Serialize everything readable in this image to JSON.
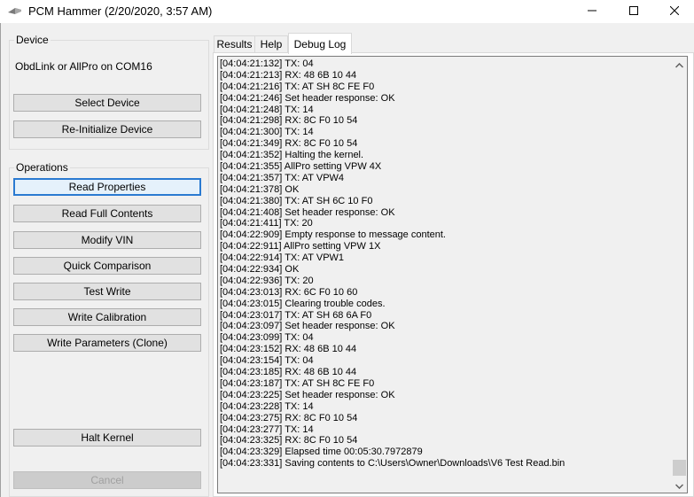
{
  "window": {
    "title": "PCM Hammer (2/20/2020, 3:57 AM)",
    "controls": {
      "minimize": "minimize-icon",
      "maximize": "maximize-icon",
      "close": "close-icon"
    }
  },
  "device_group": {
    "label": "Device",
    "device_name": "ObdLink or AllPro on COM16",
    "buttons": {
      "select": "Select Device",
      "reinit": "Re-Initialize Device"
    }
  },
  "operations_group": {
    "label": "Operations",
    "buttons": {
      "read_properties": "Read Properties",
      "read_full": "Read Full Contents",
      "modify_vin": "Modify VIN",
      "quick_compare": "Quick Comparison",
      "test_write": "Test Write",
      "write_calibration": "Write Calibration",
      "write_parameters": "Write Parameters (Clone)",
      "halt_kernel": "Halt Kernel",
      "cancel": "Cancel"
    }
  },
  "tabs": {
    "results": "Results",
    "help": "Help",
    "debug_log": "Debug Log",
    "active": "debug_log"
  },
  "debug_log": {
    "lines": [
      "[04:04:21:132]  TX: 04",
      "[04:04:21:213]  RX: 48 6B 10 44",
      "[04:04:21:216]  TX: AT SH 8C FE F0",
      "[04:04:21:246]  Set header response: OK",
      "[04:04:21:248]  TX: 14",
      "[04:04:21:298]  RX: 8C F0 10 54",
      "[04:04:21:300]  TX: 14",
      "[04:04:21:349]  RX: 8C F0 10 54",
      "[04:04:21:352]  Halting the kernel.",
      "[04:04:21:355]  AllPro setting VPW 4X",
      "[04:04:21:357]  TX: AT VPW4",
      "[04:04:21:378]  OK",
      "[04:04:21:380]  TX: AT SH 6C 10 F0",
      "[04:04:21:408]  Set header response: OK",
      "[04:04:21:411]  TX: 20",
      "[04:04:22:909]  Empty response to message content.",
      "[04:04:22:911]  AllPro setting VPW 1X",
      "[04:04:22:914]  TX: AT VPW1",
      "[04:04:22:934]  OK",
      "[04:04:22:936]  TX: 20",
      "[04:04:23:013]  RX: 6C F0 10 60",
      "[04:04:23:015]  Clearing trouble codes.",
      "[04:04:23:017]  TX: AT SH 68 6A F0",
      "[04:04:23:097]  Set header response: OK",
      "[04:04:23:099]  TX: 04",
      "[04:04:23:152]  RX: 48 6B 10 44",
      "[04:04:23:154]  TX: 04",
      "[04:04:23:185]  RX: 48 6B 10 44",
      "[04:04:23:187]  TX: AT SH 8C FE F0",
      "[04:04:23:225]  Set header response: OK",
      "[04:04:23:228]  TX: 14",
      "[04:04:23:275]  RX: 8C F0 10 54",
      "[04:04:23:277]  TX: 14",
      "[04:04:23:325]  RX: 8C F0 10 54",
      "[04:04:23:329]  Elapsed time 00:05:30.7972879",
      "[04:04:23:331]  Saving contents to C:\\Users\\Owner\\Downloads\\V6 Test Read.bin"
    ]
  },
  "colors": {
    "window_bg": "#f0f0f0",
    "button_bg": "#e1e1e1",
    "focus_border": "#2a7ad1"
  }
}
